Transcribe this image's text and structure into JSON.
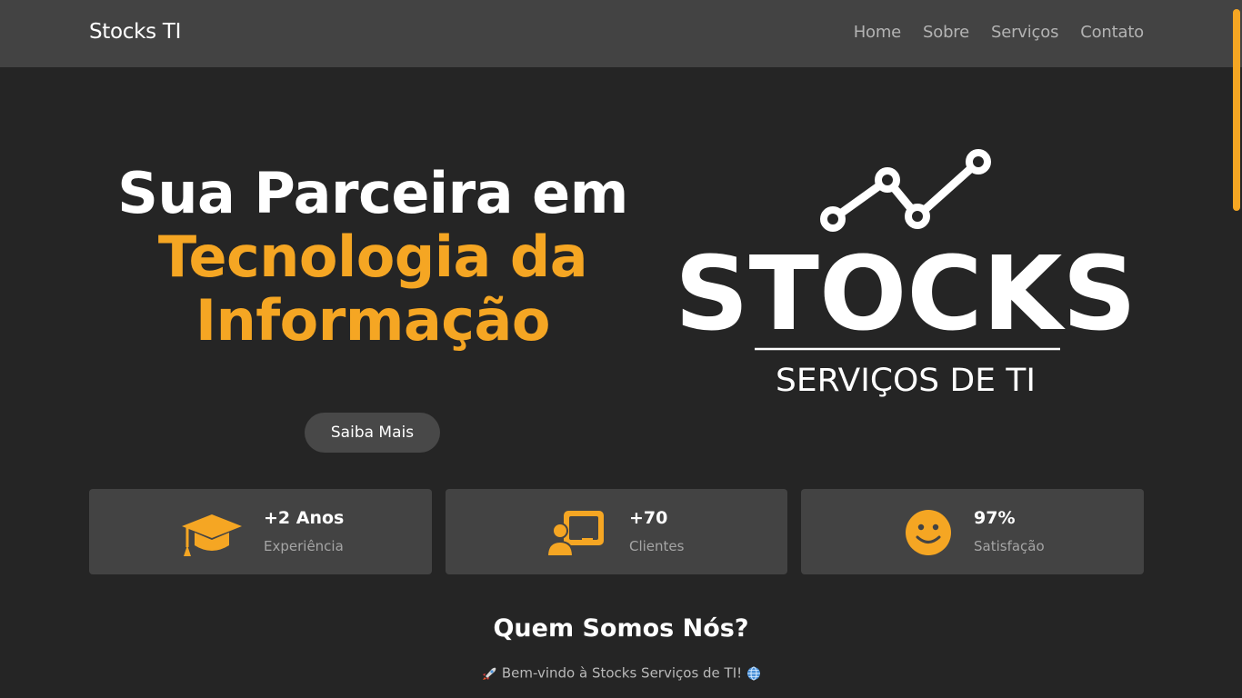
{
  "nav": {
    "brand": "Stocks TI",
    "links": [
      "Home",
      "Sobre",
      "Serviços",
      "Contato"
    ]
  },
  "hero": {
    "line1": "Sua Parceira em",
    "line2": "Tecnologia da",
    "line3": "Informação",
    "cta": "Saiba Mais"
  },
  "logo": {
    "word": "STOCKS",
    "tagline": "SERVIÇOS DE TI"
  },
  "stats": [
    {
      "icon": "graduation-cap-icon",
      "value": "+2 Anos",
      "label": "Experiência"
    },
    {
      "icon": "chalkboard-user-icon",
      "value": "+70",
      "label": "Clientes"
    },
    {
      "icon": "smile-icon",
      "value": "97%",
      "label": "Satisfação"
    }
  ],
  "about": {
    "title": "Quem Somos Nós?",
    "welcome": "Bem-vindo à Stocks Serviços de TI!",
    "welcome_icons": [
      "rocket-icon",
      "globe-icon"
    ]
  },
  "colors": {
    "accent": "#f5a623",
    "background": "#252525",
    "navbar": "#434343",
    "card": "#434343"
  }
}
